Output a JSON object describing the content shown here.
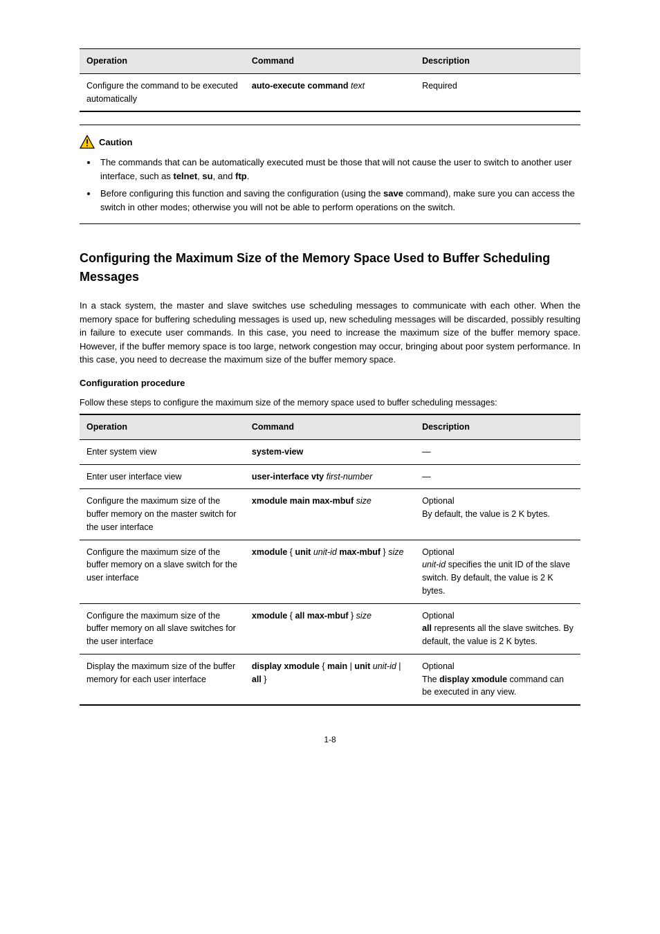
{
  "topTable": {
    "headers": [
      "Operation",
      "Command",
      "Description"
    ],
    "row": {
      "op": "Configure the command to be executed automatically",
      "cmd_cmd": "auto-execute command ",
      "cmd_arg": "text",
      "desc": "Required"
    }
  },
  "caution": {
    "label": "Caution",
    "items": [
      "The commands that can be automatically executed must be those that will not cause the user to switch to another user interface, such as telnet, su, and ftp.",
      "Before configuring this function and saving the configuration (using the save command), make sure you can access the switch in other modes; otherwise you will not be able to perform operations on the switch."
    ]
  },
  "section": {
    "heading": "Configuring the Maximum Size of the Memory Space Used to Buffer Scheduling Messages",
    "paragraph": "In a stack system, the master and slave switches use scheduling messages to communicate with each other. When the memory space for buffering scheduling messages is used up, new scheduling messages will be discarded, possibly resulting in failure to execute user commands. In this case, you need to increase the maximum size of the buffer memory space. However, if the buffer memory space is too large, network congestion may occur, bringing about poor system performance. In this case, you need to decrease the maximum size of the buffer memory space.",
    "subheading": "Configuration procedure",
    "tableCaption": "Follow these steps to configure the maximum size of the memory space used to buffer scheduling messages:"
  },
  "mainTable": {
    "headers": [
      "Operation",
      "Command",
      "Description"
    ],
    "rows": [
      {
        "op": "Enter system view",
        "cmd_cmd": "system-view",
        "cmd_arg": "",
        "desc": "—"
      },
      {
        "op": "Enter user interface view",
        "cmd_cmd": "user-interface vty ",
        "cmd_arg": "first-number",
        "desc": "—"
      },
      {
        "op": "Configure the maximum size of the buffer memory on the master switch for the user interface",
        "cmd_cmd": "xmodule main max-mbuf ",
        "cmd_arg": "size",
        "desc": "Optional\nBy default, the value is 2 K bytes."
      },
      {
        "op": "Configure the maximum size of the buffer memory on a slave switch for the user interface",
        "cmd_prefix": "xmodule ",
        "cmd_main_seg": "unit ",
        "cmd_arg1": "unit-id",
        "cmd_main_seg2": " max-mbuf",
        "cmd_arg2": "size",
        "desc_prefix": "Optional\n",
        "desc_arg": "unit-id",
        "desc_suffix": " specifies the unit ID of the slave switch. By default, the value is 2 K bytes."
      },
      {
        "op": "Configure the maximum size of the buffer memory on all slave switches for the user interface",
        "cmd_prefix": "xmodule ",
        "cmd_main_seg": "all",
        "cmd_main_seg2": " max-mbuf",
        "cmd_arg": "size",
        "desc_prefix": "Optional\n",
        "desc_arg": "all",
        "desc_suffix": " represents all the slave switches. By default, the value is 2 K bytes."
      },
      {
        "op": "Display the maximum size of the buffer memory for each user interface",
        "cmd_prefix": "display xmodule ",
        "cmd_seg_main": "main",
        "cmd_seg_unit": "unit",
        "cmd_arg_unit": "unit-id",
        "cmd_seg_all": "all",
        "desc_line1": "Optional",
        "desc_line2_cmd": "display xmodule",
        "desc_line2_suffix": " command can be executed in any view."
      }
    ]
  },
  "pageNumber": "1-8"
}
